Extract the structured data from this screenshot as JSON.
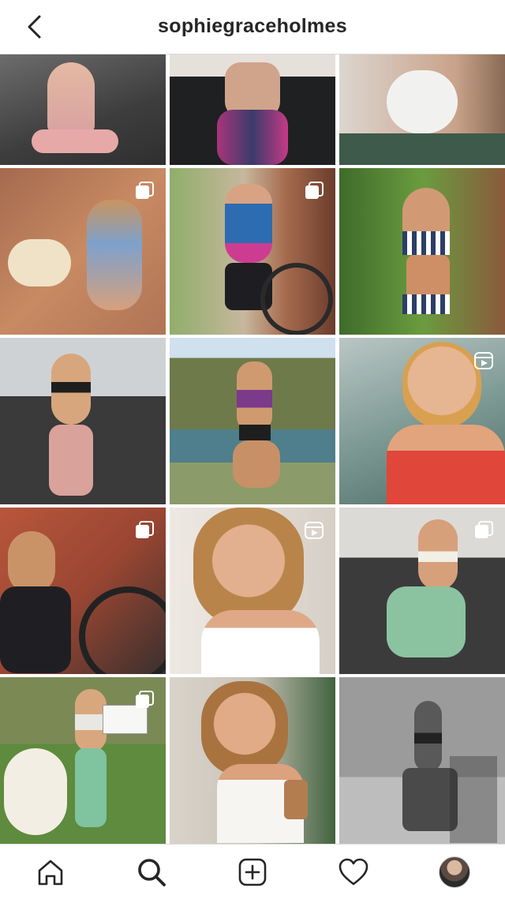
{
  "header": {
    "username": "sophiegraceholmes",
    "back_icon": "chevron-left-icon"
  },
  "grid": {
    "posts": [
      {
        "name": "post-1",
        "badge": "none"
      },
      {
        "name": "post-2",
        "badge": "none"
      },
      {
        "name": "post-3",
        "badge": "none"
      },
      {
        "name": "post-4",
        "badge": "carousel"
      },
      {
        "name": "post-5",
        "badge": "carousel"
      },
      {
        "name": "post-6",
        "badge": "none"
      },
      {
        "name": "post-7",
        "badge": "none"
      },
      {
        "name": "post-8",
        "badge": "none"
      },
      {
        "name": "post-9",
        "badge": "reel"
      },
      {
        "name": "post-10",
        "badge": "carousel"
      },
      {
        "name": "post-11",
        "badge": "reel"
      },
      {
        "name": "post-12",
        "badge": "carousel"
      },
      {
        "name": "post-13",
        "badge": "carousel"
      },
      {
        "name": "post-14",
        "badge": "none"
      },
      {
        "name": "post-15",
        "badge": "none"
      }
    ]
  },
  "nav": {
    "items": [
      "home-icon",
      "search-icon",
      "new-post-icon",
      "activity-heart-icon",
      "profile-avatar"
    ]
  }
}
